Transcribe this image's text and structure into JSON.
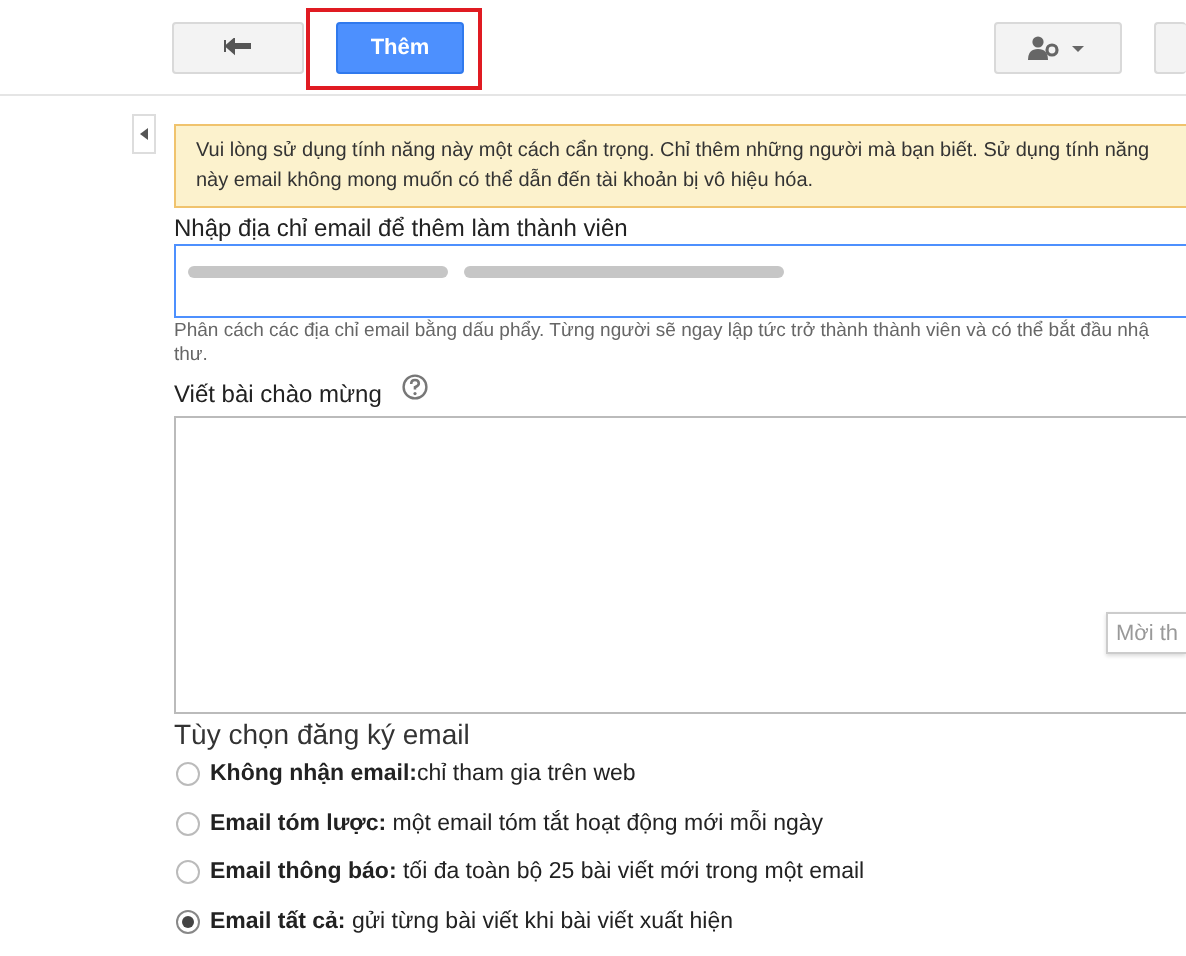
{
  "toolbar": {
    "primary_button": "Thêm",
    "primary_highlighted": true
  },
  "warning": "Vui lòng sử dụng tính năng này một cách cẩn trọng. Chỉ thêm những người mà bạn biết. Sử dụng tính năng này email không mong muốn có thể dẫn đến tài khoản bị vô hiệu hóa.",
  "emails": {
    "label": "Nhập địa chỉ email để thêm làm thành viên",
    "hint": "Phân cách các địa chỉ email bằng dấu phẩy. Từng người sẽ ngay lập tức trở thành thành viên và có thể bắt đầu nhậ thư."
  },
  "welcome": {
    "label": "Viết bài chào mừng",
    "side_button": "Mời th"
  },
  "subscription": {
    "title": "Tùy chọn đăng ký email",
    "options": [
      {
        "label": "Không nhận email:",
        "description": "chỉ tham gia trên web",
        "selected": false
      },
      {
        "label": "Email tóm lược:",
        "description": " một email tóm tắt hoạt động mới mỗi ngày",
        "selected": false
      },
      {
        "label": "Email thông báo:",
        "description": " tối đa toàn bộ 25 bài viết mới trong một email",
        "selected": false
      },
      {
        "label": "Email tất cả:",
        "description": " gửi từng bài viết khi bài viết xuất hiện",
        "selected": true
      }
    ]
  }
}
